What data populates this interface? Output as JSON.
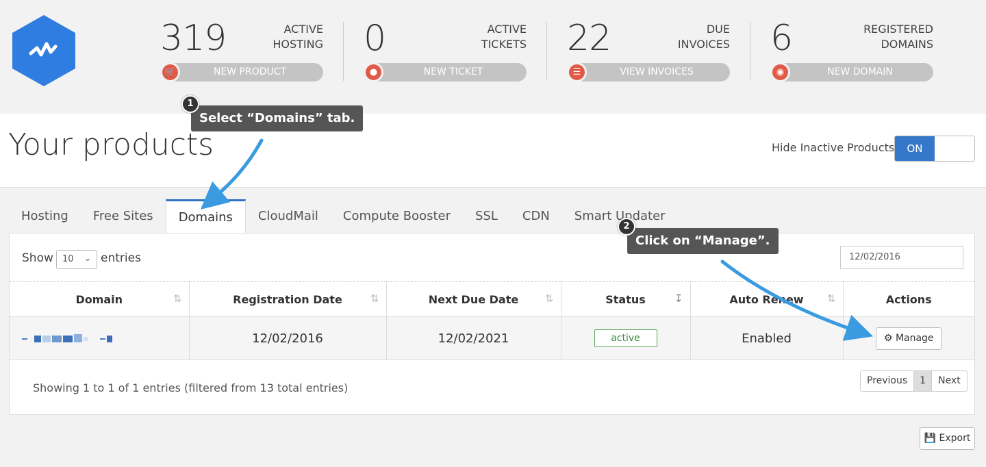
{
  "header": {
    "stats": [
      {
        "value": "319",
        "label_line1": "ACTIVE",
        "label_line2": "HOSTING",
        "button": "NEW PRODUCT",
        "icon": "cart-icon"
      },
      {
        "value": "0",
        "label_line1": "ACTIVE",
        "label_line2": "TICKETS",
        "button": "NEW TICKET",
        "icon": "chat-bubble-icon"
      },
      {
        "value": "22",
        "label_line1": "DUE",
        "label_line2": "INVOICES",
        "button": "VIEW INVOICES",
        "icon": "list-icon"
      },
      {
        "value": "6",
        "label_line1": "REGISTERED",
        "label_line2": "DOMAINS",
        "button": "NEW DOMAIN",
        "icon": "globe-icon"
      }
    ]
  },
  "page": {
    "title": "Your products",
    "hide_inactive_label": "Hide Inactive Products",
    "toggle_state": "ON"
  },
  "tabs": [
    "Hosting",
    "Free Sites",
    "Domains",
    "CloudMail",
    "Compute Booster",
    "SSL",
    "CDN",
    "Smart Updater"
  ],
  "active_tab": "Domains",
  "table_controls": {
    "show_label": "Show",
    "page_size": "10",
    "entries_label": "entries",
    "search_value": "12/02/2016"
  },
  "table": {
    "columns": [
      "Domain",
      "Registration Date",
      "Next Due Date",
      "Status",
      "Auto Renew",
      "Actions"
    ],
    "rows": [
      {
        "domain": "",
        "registration_date": "12/02/2016",
        "next_due_date": "12/02/2021",
        "status": "active",
        "auto_renew": "Enabled",
        "action": "Manage"
      }
    ]
  },
  "footer": {
    "info": "Showing 1 to 1 of 1 entries (filtered from 13 total entries)",
    "previous": "Previous",
    "current_page": "1",
    "next": "Next",
    "export": "Export"
  },
  "callouts": [
    {
      "step": "1",
      "text": "Select “Domains” tab."
    },
    {
      "step": "2",
      "text": "Click on “Manage”."
    }
  ],
  "colors": {
    "accent": "#3577c9",
    "icon_red": "#e05a47",
    "arrow": "#3a9be0",
    "status_green": "#3c8c3c"
  }
}
